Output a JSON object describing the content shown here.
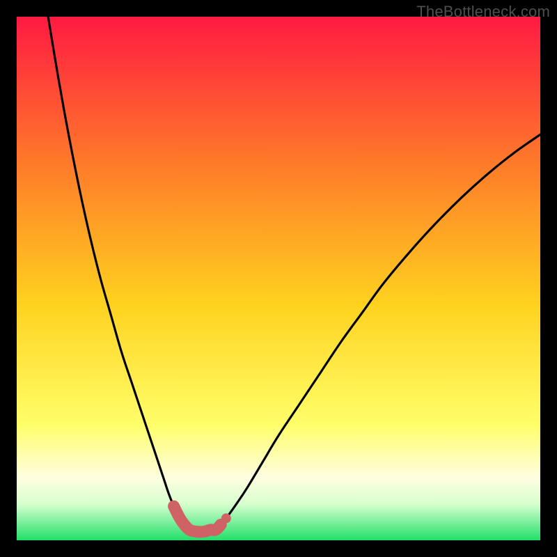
{
  "watermark": "TheBottleneck.com",
  "colors": {
    "frame_bg": "#000000",
    "grad_top": "#ff1a42",
    "grad_mid1": "#ff7a2a",
    "grad_mid2": "#ffd21f",
    "grad_mid3": "#ffff6a",
    "grad_cream": "#fefde0",
    "grad_pale": "#d8ffcf",
    "grad_green": "#22e06a",
    "curve_stroke": "#000000",
    "marker_fill": "#cf6265"
  },
  "chart_data": {
    "type": "line",
    "title": "",
    "xlabel": "",
    "ylabel": "",
    "xlim": [
      0,
      100
    ],
    "ylim": [
      0,
      100
    ],
    "note": "Axes are unlabeled; values are normalized to the plot area (0–100). Two curves descend into a narrow valley with minimum near x≈33–38 at y≈2.",
    "series": [
      {
        "name": "left-branch",
        "x": [
          6,
          8,
          10,
          12,
          14,
          16,
          18,
          20,
          22,
          24,
          26,
          28,
          29,
          30,
          31,
          32,
          33
        ],
        "y": [
          100,
          88,
          77,
          67,
          58,
          50,
          43,
          36,
          30,
          24,
          18,
          12,
          9,
          6.5,
          4.5,
          3,
          2
        ]
      },
      {
        "name": "right-branch",
        "x": [
          38,
          39,
          40,
          42,
          44,
          47,
          50,
          54,
          58,
          62,
          66,
          70,
          75,
          80,
          85,
          90,
          95,
          100
        ],
        "y": [
          2,
          3,
          4.2,
          7,
          10,
          15,
          20,
          26,
          32,
          38,
          43.5,
          49,
          55,
          60.5,
          65.5,
          70,
          74,
          77.5
        ]
      },
      {
        "name": "valley-markers",
        "type": "scatter",
        "x": [
          30,
          31,
          32,
          33,
          34,
          35,
          36,
          37,
          38,
          39,
          40
        ],
        "y": [
          6.5,
          4.5,
          3,
          2,
          1.7,
          1.6,
          1.7,
          2,
          2,
          3,
          4.2
        ]
      }
    ]
  }
}
